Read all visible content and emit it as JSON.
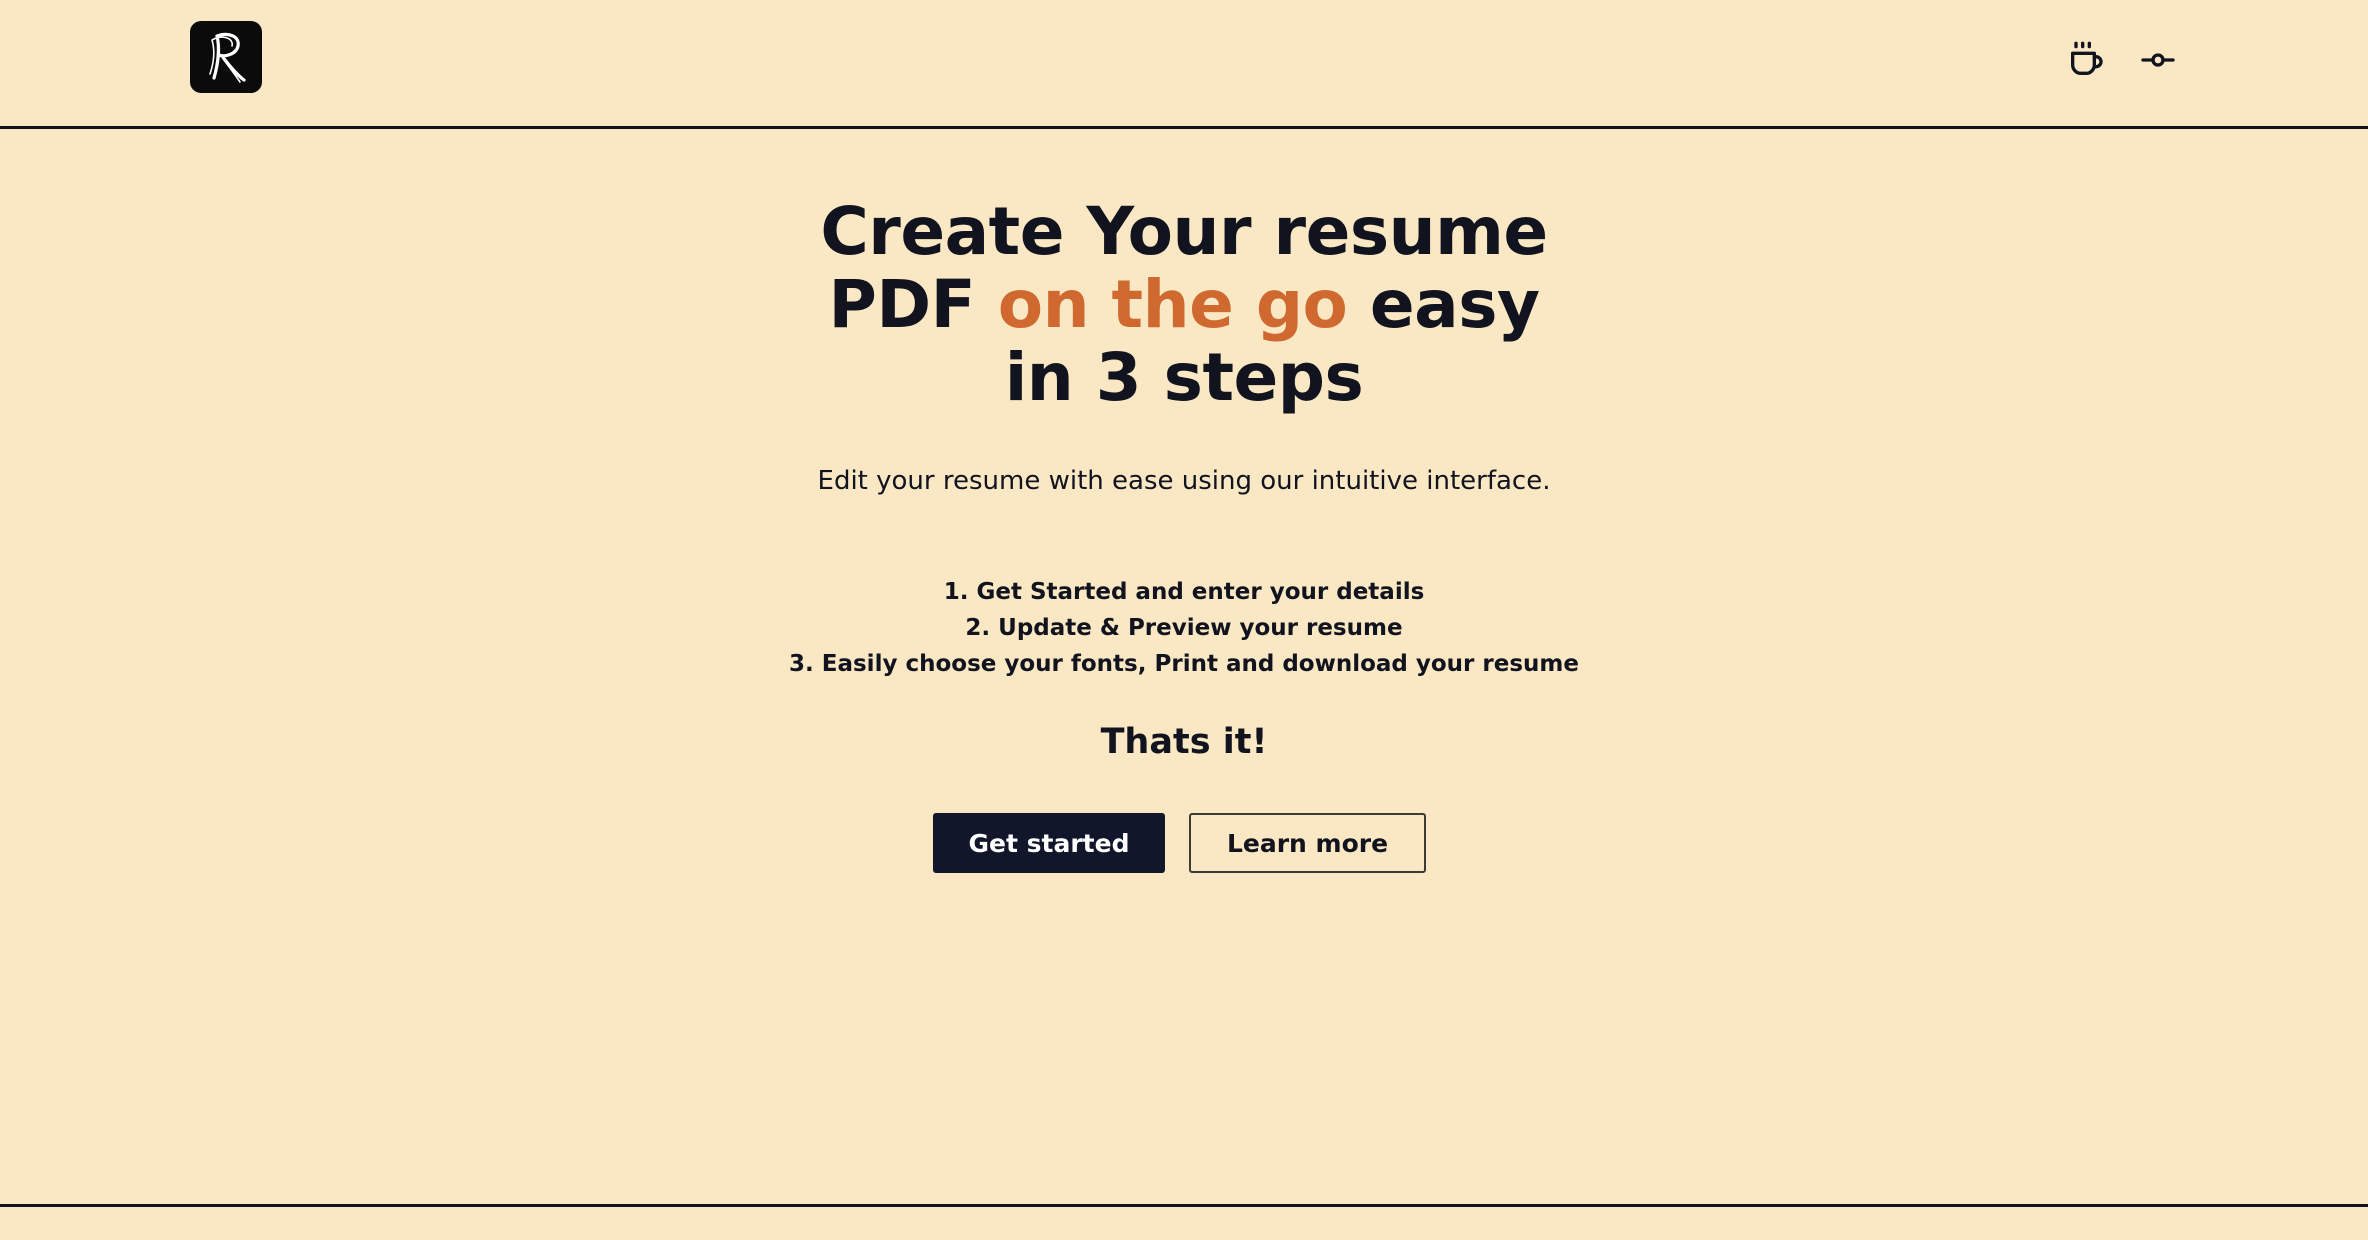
{
  "header": {
    "logo_letter": "R",
    "coffee_icon": "coffee-cup-icon",
    "commit_icon": "git-commit-icon"
  },
  "hero": {
    "title_part1": "Create Your resume PDF",
    "title_accent": "on the go",
    "title_part2": "easy in 3 steps",
    "subtitle": "Edit your resume with ease using our intuitive interface.",
    "steps": [
      "1. Get Started and enter your details",
      "2. Update & Preview your resume",
      "3. Easily choose your fonts, Print and download your resume"
    ],
    "closing": "Thats it!",
    "primary_button": "Get started",
    "secondary_button": "Learn more"
  },
  "colors": {
    "background": "#f9e8c3",
    "text": "#11131f",
    "accent": "#d0692f",
    "primary_button_bg": "#11162b"
  }
}
